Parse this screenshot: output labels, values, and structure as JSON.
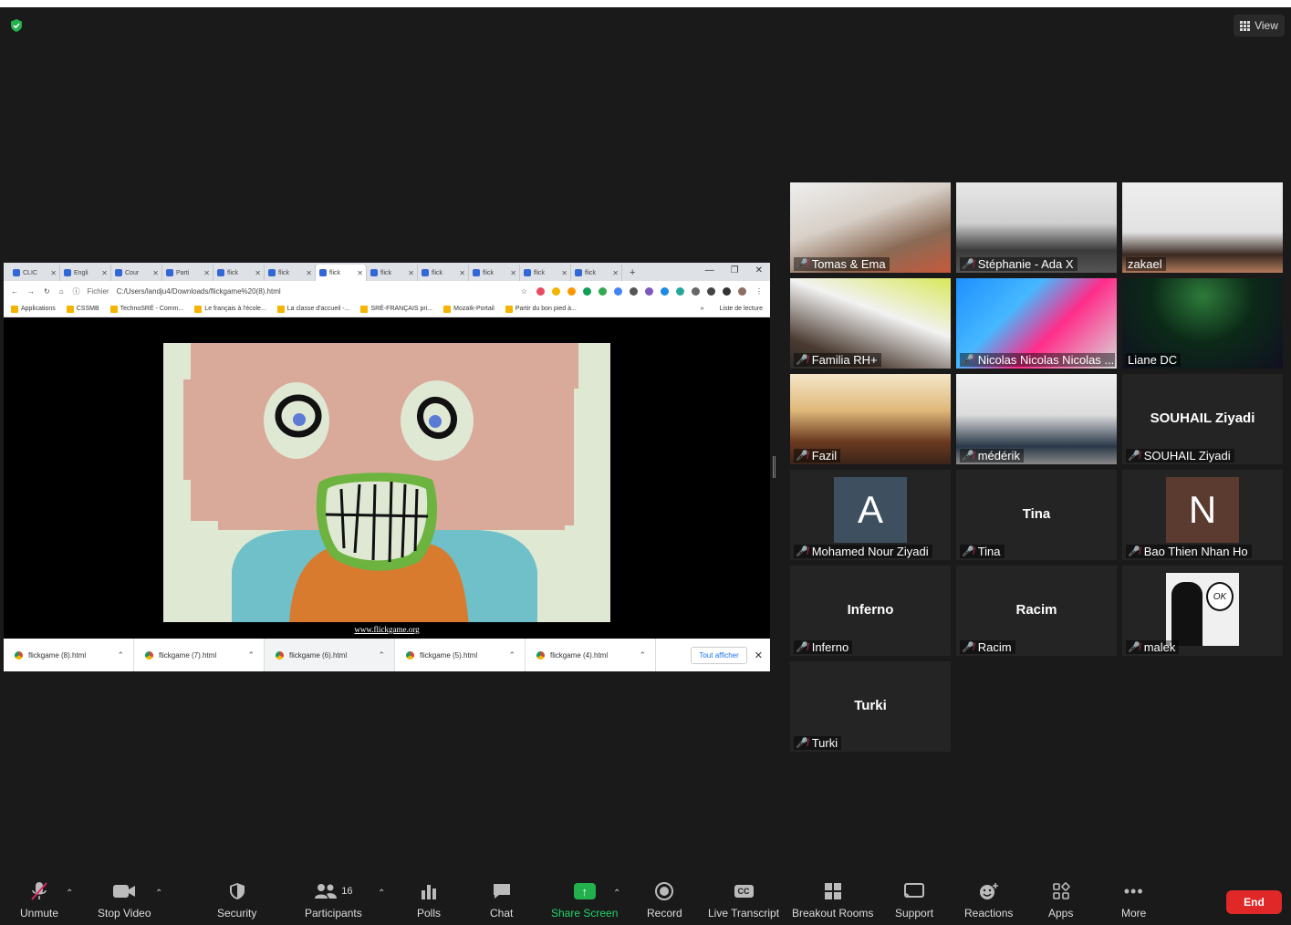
{
  "window": {
    "view_label": "View"
  },
  "browser": {
    "tabs": [
      "CLIC",
      "Engli",
      "Cour",
      "Parti",
      "flick",
      "flick",
      "flick",
      "flick",
      "flick",
      "flick",
      "flick",
      "flick"
    ],
    "active_tab_index": 6,
    "address_label": "Fichier",
    "address_url": "C:/Users/landju4/Downloads/flickgame%20(8).html",
    "bookmarks": [
      "Applications",
      "CSSMB",
      "TechnoSRÉ - Comm...",
      "Le français à l'école...",
      "La classe d'accueil -...",
      "SRÉ-FRANÇAIS pri...",
      "Mozaïk-Portail",
      "Partir du bon pied à..."
    ],
    "reading_list": "Liste de lecture",
    "page_link": "www.flickgame.org",
    "downloads": [
      "flickgame (8).html",
      "flickgame (7).html",
      "flickgame (6).html",
      "flickgame (5).html",
      "flickgame (4).html"
    ],
    "show_all": "Tout afficher"
  },
  "participants": [
    {
      "name": "Tomas & Ema",
      "muted": true
    },
    {
      "name": "Stéphanie - Ada X",
      "muted": true
    },
    {
      "name": "zakael",
      "muted": false
    },
    {
      "name": "Familia RH+",
      "muted": true
    },
    {
      "name": "Nicolas Nicolas Nicolas ...",
      "muted": true
    },
    {
      "name": "Liane DC",
      "muted": false,
      "speaking": true
    },
    {
      "name": "Fazil",
      "muted": true
    },
    {
      "name": "médérik",
      "muted": true
    },
    {
      "name": "SOUHAIL  Ziyadi",
      "muted": true,
      "display": "SOUHAIL  Ziyadi"
    },
    {
      "name": "Mohamed Nour Ziyadi",
      "muted": true,
      "avatar": "A",
      "avatar_color": "#3e5060"
    },
    {
      "name": "Tina",
      "muted": true,
      "display": "Tina"
    },
    {
      "name": "Bao Thien Nhan Ho",
      "muted": true,
      "avatar": "N",
      "avatar_color": "#5b3a30"
    },
    {
      "name": "Inferno",
      "muted": true,
      "display": "Inferno"
    },
    {
      "name": "Racim",
      "muted": true,
      "display": "Racim"
    },
    {
      "name": "malek",
      "muted": true
    },
    {
      "name": "Turki",
      "muted": true,
      "display": "Turki"
    }
  ],
  "toolbar": {
    "unmute": "Unmute",
    "stop_video": "Stop Video",
    "security": "Security",
    "participants": "Participants",
    "participants_count": "16",
    "polls": "Polls",
    "chat": "Chat",
    "share_screen": "Share Screen",
    "record": "Record",
    "live_transcript": "Live Transcript",
    "live_transcript_badge": "CC",
    "breakout_rooms": "Breakout Rooms",
    "support": "Support",
    "reactions": "Reactions",
    "apps": "Apps",
    "more": "More",
    "end": "End"
  },
  "colors": {
    "accent_green": "#22b14c",
    "end_red": "#e02828",
    "active_speaker": "#d8e33c",
    "muted_red": "#e0245e"
  }
}
